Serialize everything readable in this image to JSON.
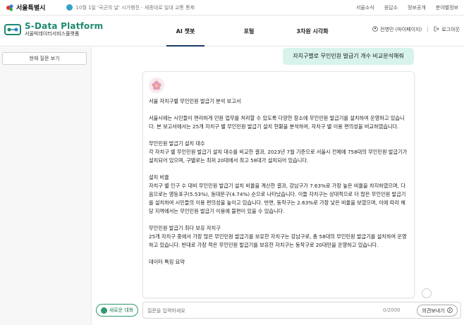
{
  "gov_bar": {
    "logo": "서울특별시",
    "notice": "10월 1일 '국군의 날' 시가행진 - 세종대로 일대 교통 통제",
    "links": [
      "서울소식",
      "응답소",
      "정보공개",
      "분야별정보"
    ]
  },
  "header": {
    "brand_title": "S-Data Platform",
    "brand_sub": "서울빅데이터서비스플랫폼",
    "nav": [
      "AI 챗봇",
      "포털",
      "3차원 시각화"
    ],
    "user": "전영민 (마이페이지)",
    "logout": "로그아웃"
  },
  "left": {
    "questions_btn": "현재 질문 보기",
    "newchat_btn": "새로운 대화"
  },
  "chat": {
    "user_message": "자치구별로 무인민원 발급기 개수 비교분석해줘",
    "answer": {
      "title": "서울 자치구별 무인민원 발급기 분석 보고서",
      "intro": "서울시에는 시민들이 편리하게 민원 업무를 처리할 수 있도록 다양한 장소에 무인민원 발급기를 설치하여 운영하고 있습니다. 본 보고서에서는 25개 자치구 별 무인민원 발급기 설치 현황을 분석하여, 자치구 별 이용 편의성을 비교하였습니다.",
      "s1_title": "무인민원 발급기 설치 대수",
      "s1_body": "각 자치구 별 무인민원 발급기 설치 대수를 비교한 결과, 2023년 7월 기준으로 서울시 전체에 758대의 무인민원 발급기가 설치되어 있으며, 구별로는 최저 20대에서 최고 58대가 설치되어 있습니다.",
      "s2_title": "설치 비율",
      "s2_body": "자치구 별 인구 수 대비 무인민원 발급기 설치 비율을 계산한 결과, 강남구가 7.63%로 가장 높은 비율을 차지하였으며, 다음으로는 영등포구(5.53%), 동대문구(4.74%) 순으로 나타났습니다. 이들 자치구는 상대적으로 더 많은 무인민원 발급기를 설치하여 시민들의 이용 편의성을 높이고 있습니다. 반면, 동작구는 2.63%로 가장 낮은 비율을 보였으며, 이에 따라 해당 지역에서는 무인민원 발급기 이용에 불편이 있을 수 있습니다.",
      "s3_title": "무인민원 발급기 최다 보유 자치구",
      "s3_body": "25개 자치구 중에서 가장 많은 무인민원 발급기를 보유한 자치구는 강남구로, 총 58대의 무인민원 발급기를 설치하여 운영하고 있습니다. 반대로 가장 적은 무인민원 발급기를 보유한 자치구는 동작구로 20대만을 운영하고 있습니다.",
      "s4_title": "데이터 특징 요약"
    }
  },
  "input": {
    "placeholder": "질문을 입력하세요",
    "count": "0/2000",
    "send": "의견보내기"
  },
  "colors": {
    "brand": "#1f8a70",
    "bubble": "#d8f2ec",
    "accent_green": "#2c9b6b"
  }
}
